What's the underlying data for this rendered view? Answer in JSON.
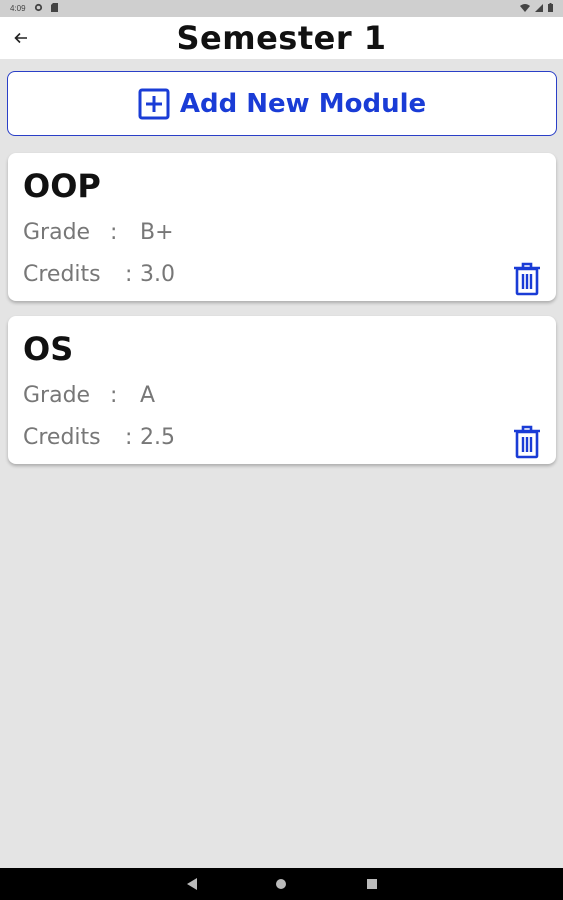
{
  "status_bar": {
    "time": "4:09"
  },
  "app_bar": {
    "title": "Semester 1"
  },
  "add_module": {
    "label": "Add New Module"
  },
  "modules": [
    {
      "name": "OOP",
      "grade_label": "Grade",
      "grade_sep": ":",
      "grade": "B+",
      "credits_label": "Credits",
      "credits_sep": ":",
      "credits": "3.0"
    },
    {
      "name": "OS",
      "grade_label": "Grade",
      "grade_sep": ":",
      "grade": "A",
      "credits_label": "Credits",
      "credits_sep": ":",
      "credits": "2.5"
    }
  ],
  "colors": {
    "accent": "#1a3cd6",
    "background": "#e4e4e4",
    "card": "#ffffff"
  },
  "icons": [
    "back-arrow-icon",
    "add-box-icon",
    "trash-icon",
    "nav-back-icon",
    "nav-home-icon",
    "nav-recents-icon"
  ]
}
